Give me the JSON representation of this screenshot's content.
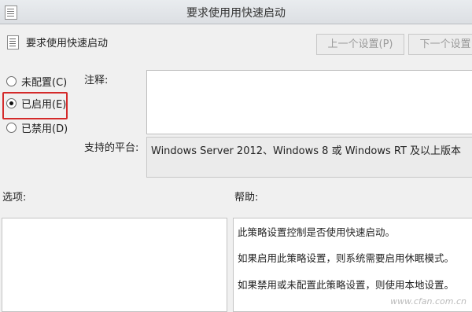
{
  "window": {
    "title": "要求使用用快速启动"
  },
  "header": {
    "policy_name": "要求使用快速启动",
    "prev_button": "上一个设置(P)",
    "next_button": "下一个设置"
  },
  "radio_options": [
    {
      "label": "未配置(C)",
      "checked": false
    },
    {
      "label": "已启用(E)",
      "checked": true
    },
    {
      "label": "已禁用(D)",
      "checked": false
    }
  ],
  "comment": {
    "label": "注释:",
    "value": ""
  },
  "platform": {
    "label": "支持的平台:",
    "value": "Windows Server 2012、Windows 8 或 Windows RT 及以上版本"
  },
  "options": {
    "label": "选项:"
  },
  "help": {
    "label": "帮助:",
    "lines": [
      "此策略设置控制是否使用快速启动。",
      "如果启用此策略设置，则系统需要启用休眠模式。",
      "如果禁用或未配置此策略设置，则使用本地设置。"
    ]
  },
  "watermark": "www.cfan.com.cn"
}
